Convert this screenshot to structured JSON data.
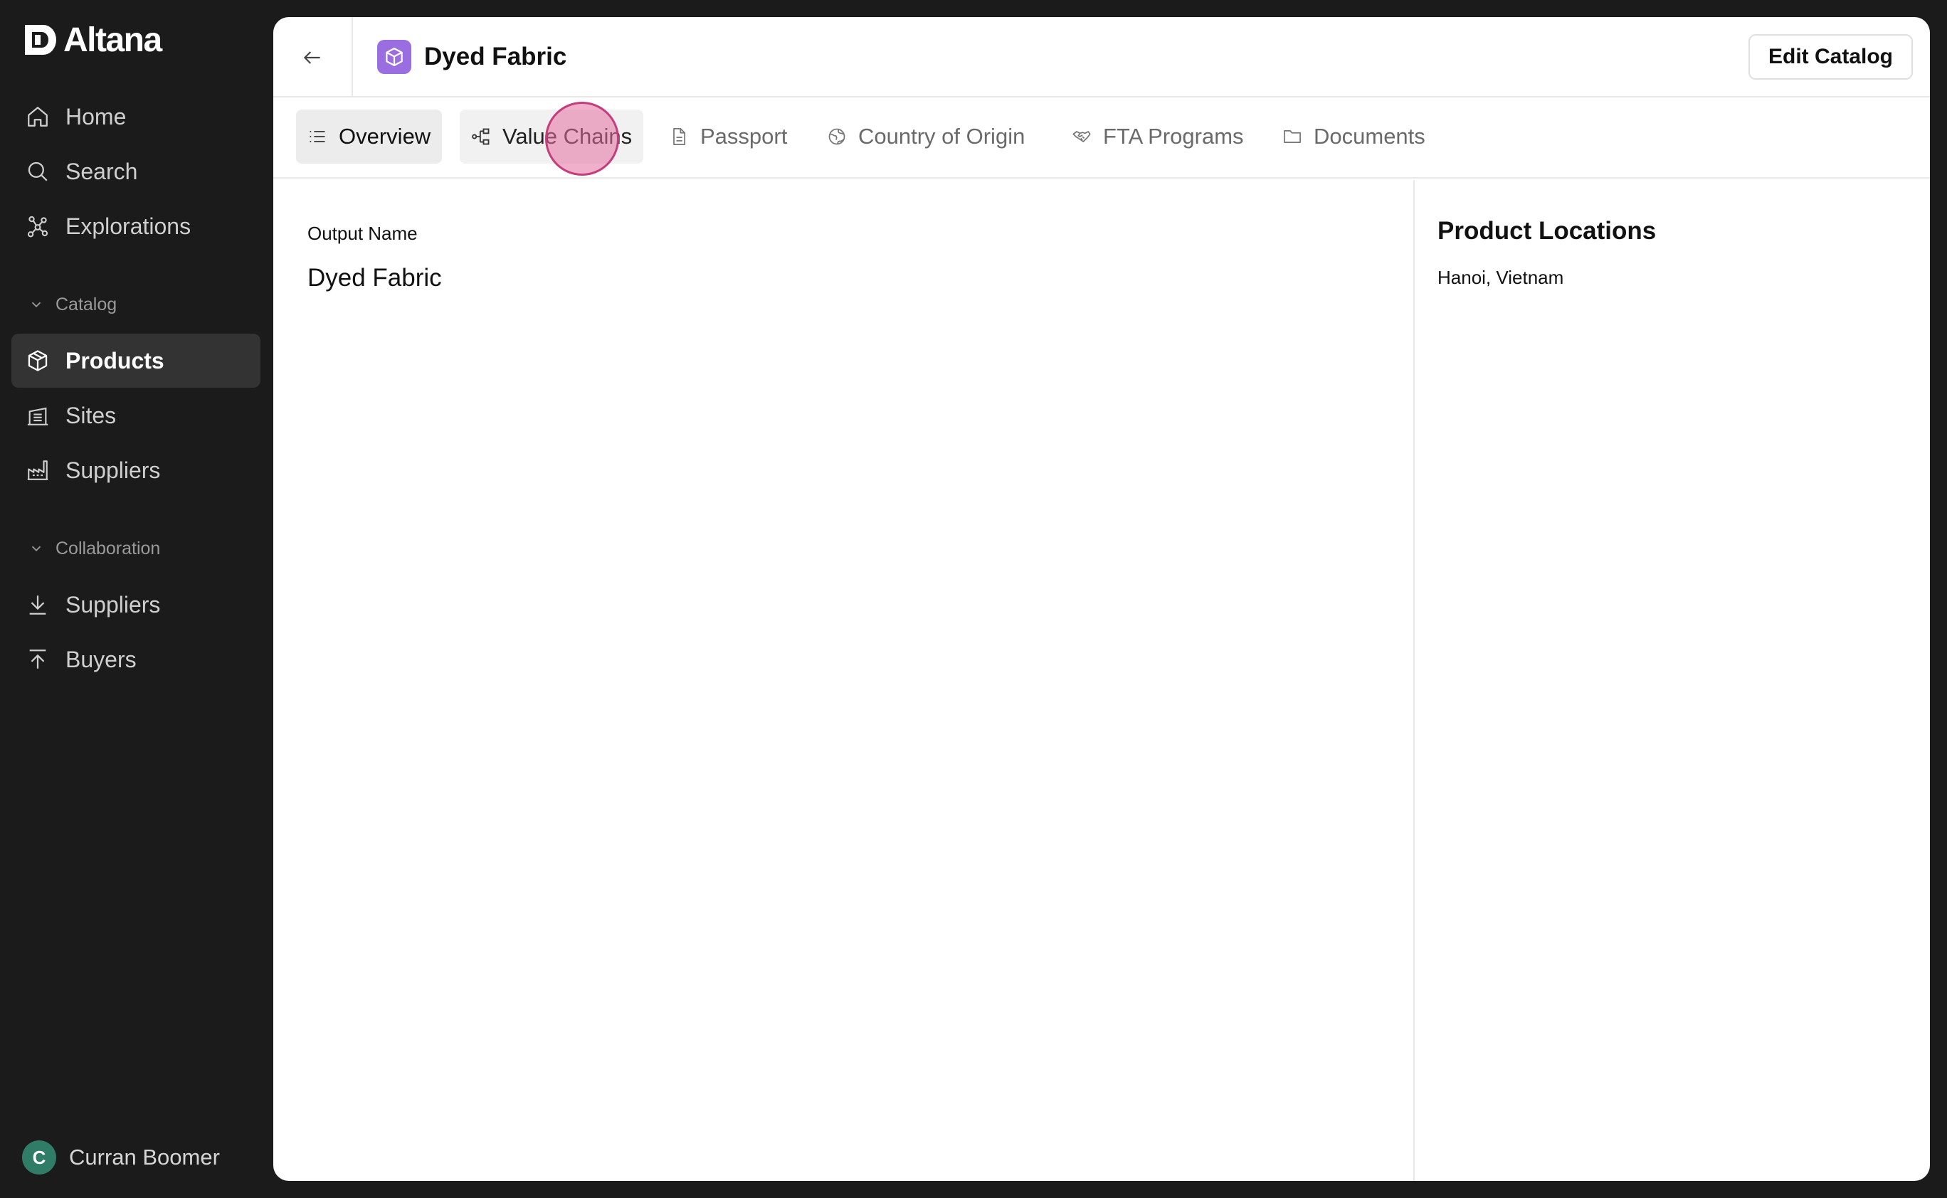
{
  "app": {
    "name": "Altana"
  },
  "sidebar": {
    "nav": [
      {
        "label": "Home",
        "icon": "home-icon"
      },
      {
        "label": "Search",
        "icon": "search-icon"
      },
      {
        "label": "Explorations",
        "icon": "network-icon"
      }
    ],
    "sections": [
      {
        "label": "Catalog",
        "items": [
          {
            "label": "Products",
            "icon": "cube-icon",
            "active": true
          },
          {
            "label": "Sites",
            "icon": "warehouse-icon"
          },
          {
            "label": "Suppliers",
            "icon": "factory-icon"
          }
        ]
      },
      {
        "label": "Collaboration",
        "items": [
          {
            "label": "Suppliers",
            "icon": "arrow-down-to-line-icon"
          },
          {
            "label": "Buyers",
            "icon": "arrow-up-from-line-icon"
          }
        ]
      }
    ],
    "user": {
      "initial": "C",
      "name": "Curran Boomer"
    }
  },
  "header": {
    "title": "Dyed Fabric",
    "edit_label": "Edit Catalog"
  },
  "tabs": [
    {
      "label": "Overview",
      "icon": "list-icon",
      "active": true
    },
    {
      "label": "Value Chains",
      "icon": "hierarchy-icon"
    },
    {
      "label": "Passport",
      "icon": "document-icon"
    },
    {
      "label": "Country of Origin",
      "icon": "globe-icon"
    },
    {
      "label": "FTA Programs",
      "icon": "handshake-icon"
    },
    {
      "label": "Documents",
      "icon": "folder-icon"
    }
  ],
  "overview": {
    "output_name_label": "Output Name",
    "output_name_value": "Dyed Fabric"
  },
  "locations": {
    "heading": "Product Locations",
    "value": "Hanoi, Vietnam"
  },
  "colors": {
    "sidebar_bg": "#1b1b1b",
    "active_nav_bg": "#333333",
    "product_badge": "#9a6ee0",
    "avatar_bg": "#2f7d67",
    "cursor_highlight": "#e46ea0"
  }
}
